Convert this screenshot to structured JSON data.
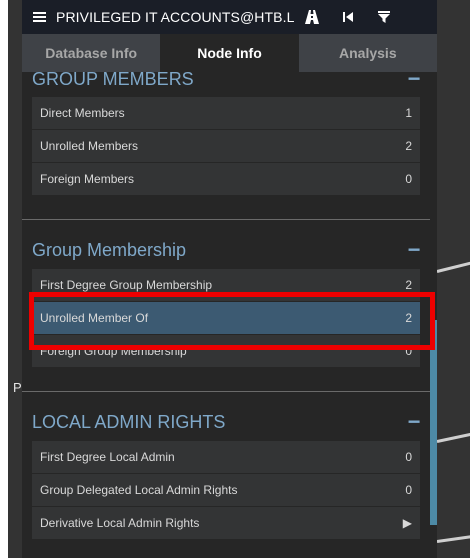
{
  "header": {
    "title": "PRIVILEGED IT ACCOUNTS@HTB.L",
    "icons": [
      "menu-icon",
      "road-icon",
      "step-back-icon",
      "filter-icon"
    ]
  },
  "tabs": [
    {
      "label": "Database Info",
      "active": false
    },
    {
      "label": "Node Info",
      "active": true
    },
    {
      "label": "Analysis",
      "active": false
    }
  ],
  "background": {
    "node_label": "P"
  },
  "sections": {
    "group_members": {
      "title": "GROUP MEMBERS",
      "rows": [
        {
          "label": "Direct Members",
          "value": "1"
        },
        {
          "label": "Unrolled Members",
          "value": "2"
        },
        {
          "label": "Foreign Members",
          "value": "0"
        }
      ]
    },
    "group_membership": {
      "title": "Group Membership",
      "rows": [
        {
          "label": "First Degree Group Membership",
          "value": "2"
        },
        {
          "label": "Unrolled Member Of",
          "value": "2"
        },
        {
          "label": "Foreign Group Membership",
          "value": "0"
        }
      ]
    },
    "local_admin": {
      "title": "LOCAL ADMIN RIGHTS",
      "rows": [
        {
          "label": "First Degree Local Admin",
          "value": "0"
        },
        {
          "label": "Group Delegated Local Admin Rights",
          "value": "0"
        },
        {
          "label": "Derivative Local Admin Rights",
          "value": "▶"
        }
      ]
    }
  },
  "colors": {
    "accent": "#7fa8c9",
    "highlight": "#3c5a72",
    "annotation": "#ee0000"
  }
}
